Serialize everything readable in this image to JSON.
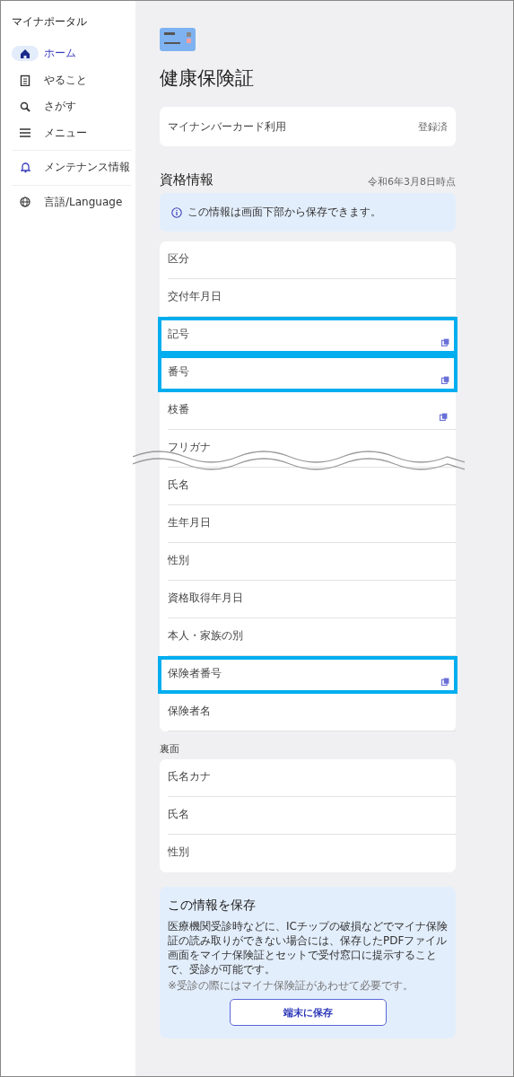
{
  "sidebar": {
    "title": "マイナポータル",
    "items": [
      {
        "label": "ホーム",
        "selected": true
      },
      {
        "label": "やること",
        "selected": false
      },
      {
        "label": "さがす",
        "selected": false
      },
      {
        "label": "メニュー",
        "selected": false
      },
      {
        "label": "メンテナンス情報",
        "selected": false
      },
      {
        "label": "言語/Language",
        "selected": false
      }
    ]
  },
  "page": {
    "title": "健康保険証",
    "card_usage": {
      "label": "マイナンバーカード利用",
      "status": "登録済"
    },
    "section": {
      "title": "資格情報",
      "as_of": "令和6年3月8日時点"
    },
    "info": "この情報は画面下部から保存できます。",
    "front_fields": [
      {
        "label": "区分",
        "copyable": false,
        "highlighted": false
      },
      {
        "label": "交付年月日",
        "copyable": false,
        "highlighted": false
      },
      {
        "label": "記号",
        "copyable": true,
        "highlighted": true
      },
      {
        "label": "番号",
        "copyable": true,
        "highlighted": true
      },
      {
        "label": "枝番",
        "copyable": true,
        "highlighted": false
      },
      {
        "label": "フリガナ",
        "copyable": false,
        "highlighted": false
      },
      {
        "label": "氏名",
        "copyable": false,
        "highlighted": false
      },
      {
        "label": "生年月日",
        "copyable": false,
        "highlighted": false
      },
      {
        "label": "性別",
        "copyable": false,
        "highlighted": false
      },
      {
        "label": "資格取得年月日",
        "copyable": false,
        "highlighted": false
      },
      {
        "label": "本人・家族の別",
        "copyable": false,
        "highlighted": false
      },
      {
        "label": "保険者番号",
        "copyable": true,
        "highlighted": true
      },
      {
        "label": "保険者名",
        "copyable": false,
        "highlighted": false
      }
    ],
    "back_label": "裏面",
    "back_fields": [
      "氏名カナ",
      "氏名",
      "性別"
    ],
    "save": {
      "title": "この情報を保存",
      "body": "医療機関受診時などに、ICチップの破損などでマイナ保険証の読み取りができない場合には、保存したPDFファイル画面をマイナ保険証とセットで受付窓口に提示することで、受診が可能です。",
      "note": "※受診の際にはマイナ保険証があわせて必要です。",
      "button": "端末に保存"
    }
  }
}
